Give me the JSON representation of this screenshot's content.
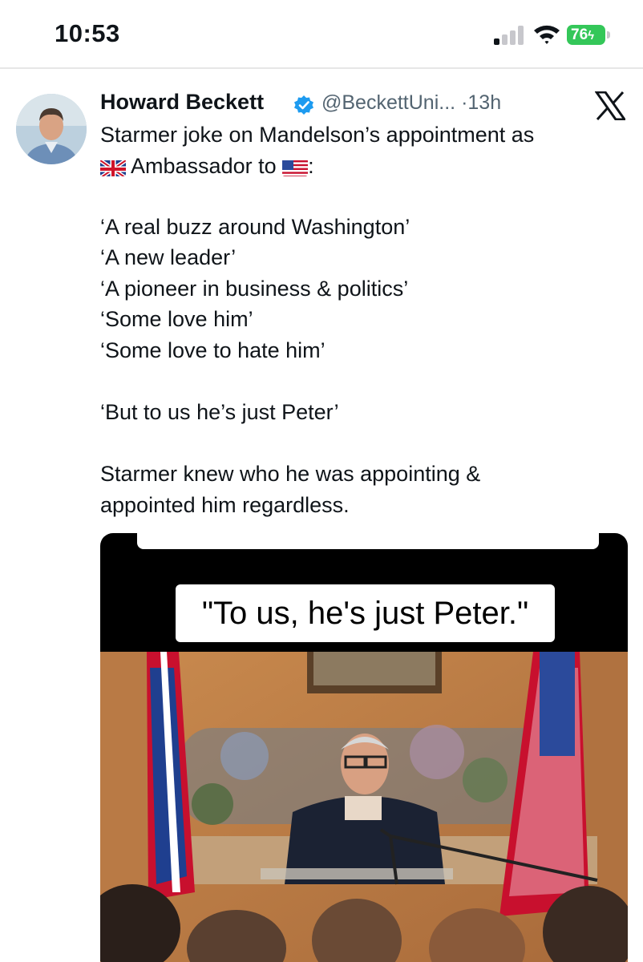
{
  "status_bar": {
    "time": "10:53",
    "battery": "76"
  },
  "tweet": {
    "author_name": "Howard Beckett",
    "handle": "@BeckettUni...",
    "separator": "·",
    "time_ago": "13h",
    "lines": [
      "Starmer joke on Mandelson’s appointment as",
      "Ambassador to",
      ":",
      "‘A real buzz around Washington’",
      "‘A new leader’",
      "‘A pioneer in business & politics’",
      "‘Some love him’",
      "‘Some love to hate him’",
      "‘But to us he’s just Peter’",
      "Starmer knew who he was appointing &",
      "appointed him regardless."
    ],
    "icons": {
      "verified": "verified-badge-icon",
      "platform": "x-logo-icon",
      "flag_1": "uk-flag-icon",
      "flag_2": "us-flag-icon"
    }
  },
  "media": {
    "caption": "\"To us, he's just Peter.\""
  },
  "colors": {
    "text": "#0f1419",
    "secondary_text": "#536471",
    "verified_blue": "#1d9bf0",
    "battery_green": "#34c759"
  }
}
